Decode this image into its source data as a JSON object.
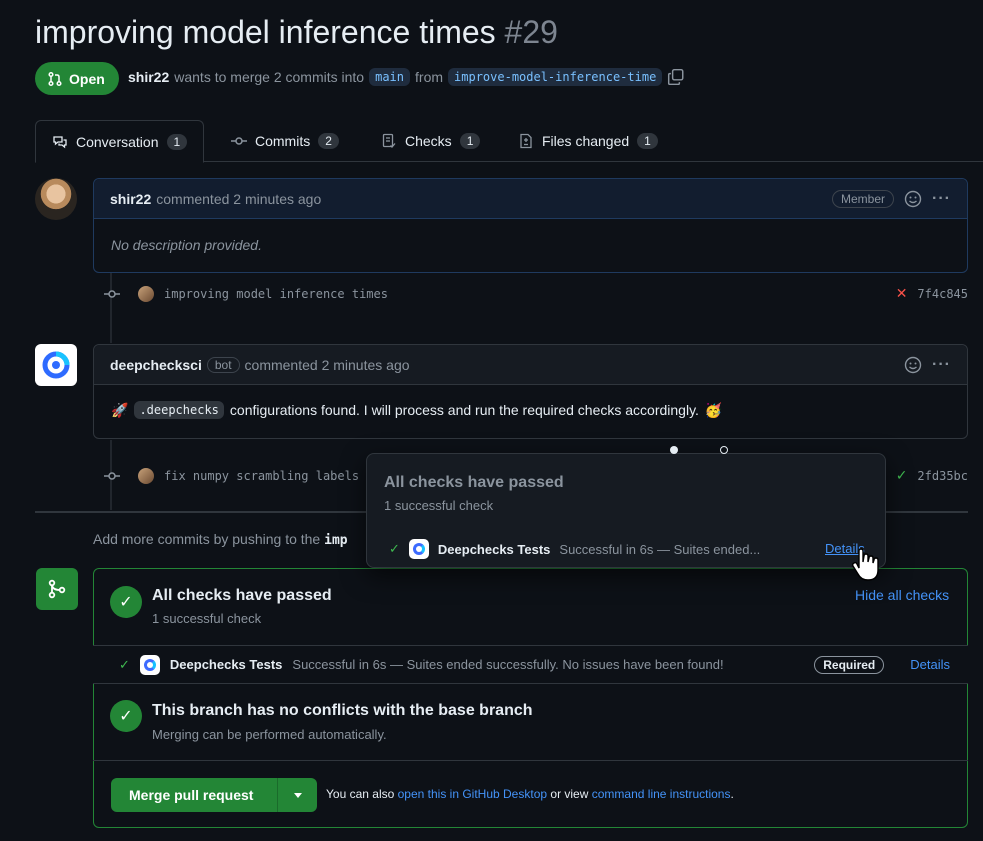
{
  "pr": {
    "title": "improving model inference times",
    "number": "#29",
    "state": "Open",
    "author": "shir22",
    "merge_text": "wants to merge 2 commits into",
    "base_branch": "main",
    "from_text": "from",
    "head_branch": "improve-model-inference-time"
  },
  "tabs": [
    {
      "label": "Conversation",
      "count": "1"
    },
    {
      "label": "Commits",
      "count": "2"
    },
    {
      "label": "Checks",
      "count": "1"
    },
    {
      "label": "Files changed",
      "count": "1"
    }
  ],
  "comment1": {
    "author": "shir22",
    "meta": "commented 2 minutes ago",
    "role": "Member",
    "body": "No description provided."
  },
  "commit1": {
    "message": "improving model inference times",
    "sha": "7f4c845",
    "status": "✕"
  },
  "comment2": {
    "author": "deepchecksci",
    "bot_label": "bot",
    "meta": "commented 2 minutes ago",
    "rocket": "🚀",
    "code": ".deepchecks",
    "body": "configurations found. I will process and run the required checks accordingly.",
    "emoji": "🥳"
  },
  "commit2": {
    "message": "fix numpy scrambling labels",
    "sha": "2fd35bc",
    "status": "✓"
  },
  "push_hint": {
    "text": "Add more commits by pushing to the",
    "branch": "imp"
  },
  "popover": {
    "title": "All checks have passed",
    "sub": "1 successful check",
    "check_name": "Deepchecks Tests",
    "check_desc": "Successful in 6s — Suites ended...",
    "details": "Details"
  },
  "merge": {
    "checks_title": "All checks have passed",
    "checks_sub": "1 successful check",
    "hide_label": "Hide all checks",
    "check_name": "Deepchecks Tests",
    "check_desc": "Successful in 6s — Suites ended successfully. No issues have been found!",
    "required_label": "Required",
    "details_label": "Details",
    "conflict_title": "This branch has no conflicts with the base branch",
    "conflict_sub": "Merging can be performed automatically.",
    "button_label": "Merge pull request",
    "also_text": "You can also",
    "desktop_link": "open this in GitHub Desktop",
    "or_text": "or view",
    "cli_link": "command line instructions",
    "period": "."
  },
  "colors": {
    "accent_green": "#238636",
    "link_blue": "#4493f8",
    "background": "#0d1117"
  }
}
